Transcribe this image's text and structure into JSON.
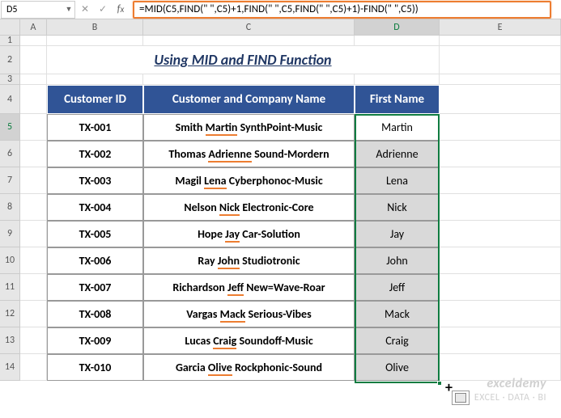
{
  "namebox": "D5",
  "formula": "=MID(C5,FIND(\" \",C5)+1,FIND(\" \",C5,FIND(\" \",C5)+1)-FIND(\" \",C5))",
  "columns": [
    "A",
    "B",
    "C",
    "D",
    "E"
  ],
  "title": "Using MID and FIND Function",
  "headers": {
    "id": "Customer ID",
    "name": "Customer and Company Name",
    "first": "First Name"
  },
  "data": [
    {
      "id": "TX-001",
      "pre": "Smith ",
      "mid": "Martin",
      "post": " SynthPoint-Music",
      "first": "Martin"
    },
    {
      "id": "TX-002",
      "pre": "Thomas ",
      "mid": "Adrienne",
      "post": " Sound-Mordern",
      "first": "Adrienne"
    },
    {
      "id": "TX-003",
      "pre": "Magil ",
      "mid": "Lena",
      "post": " Cyberphonoc-Music",
      "first": "Lena"
    },
    {
      "id": "TX-004",
      "pre": "Nelson ",
      "mid": "Nick",
      "post": " Electronic-Core",
      "first": "Nick"
    },
    {
      "id": "TX-005",
      "pre": "Hope ",
      "mid": "Jay",
      "post": " Car-Solution",
      "first": "Jay"
    },
    {
      "id": "TX-006",
      "pre": "Ray ",
      "mid": "John",
      "post": " Studiotronic",
      "first": "John"
    },
    {
      "id": "TX-007",
      "pre": "Richardson ",
      "mid": "Jeff",
      "post": " New=Wave-Roar",
      "first": "Jeff"
    },
    {
      "id": "TX-008",
      "pre": "Vargas ",
      "mid": "Mack",
      "post": " Serious-Vibes",
      "first": "Mack"
    },
    {
      "id": "TX-009",
      "pre": "Lucas ",
      "mid": "Craig",
      "post": " Soundoff-Music",
      "first": "Craig"
    },
    {
      "id": "TX-010",
      "pre": "Garcia ",
      "mid": "Olive",
      "post": " Rockphonic-Sound",
      "first": "Olive"
    }
  ],
  "watermark": {
    "line1": "exceldemy",
    "line2": "EXCEL · DATA · BI"
  }
}
